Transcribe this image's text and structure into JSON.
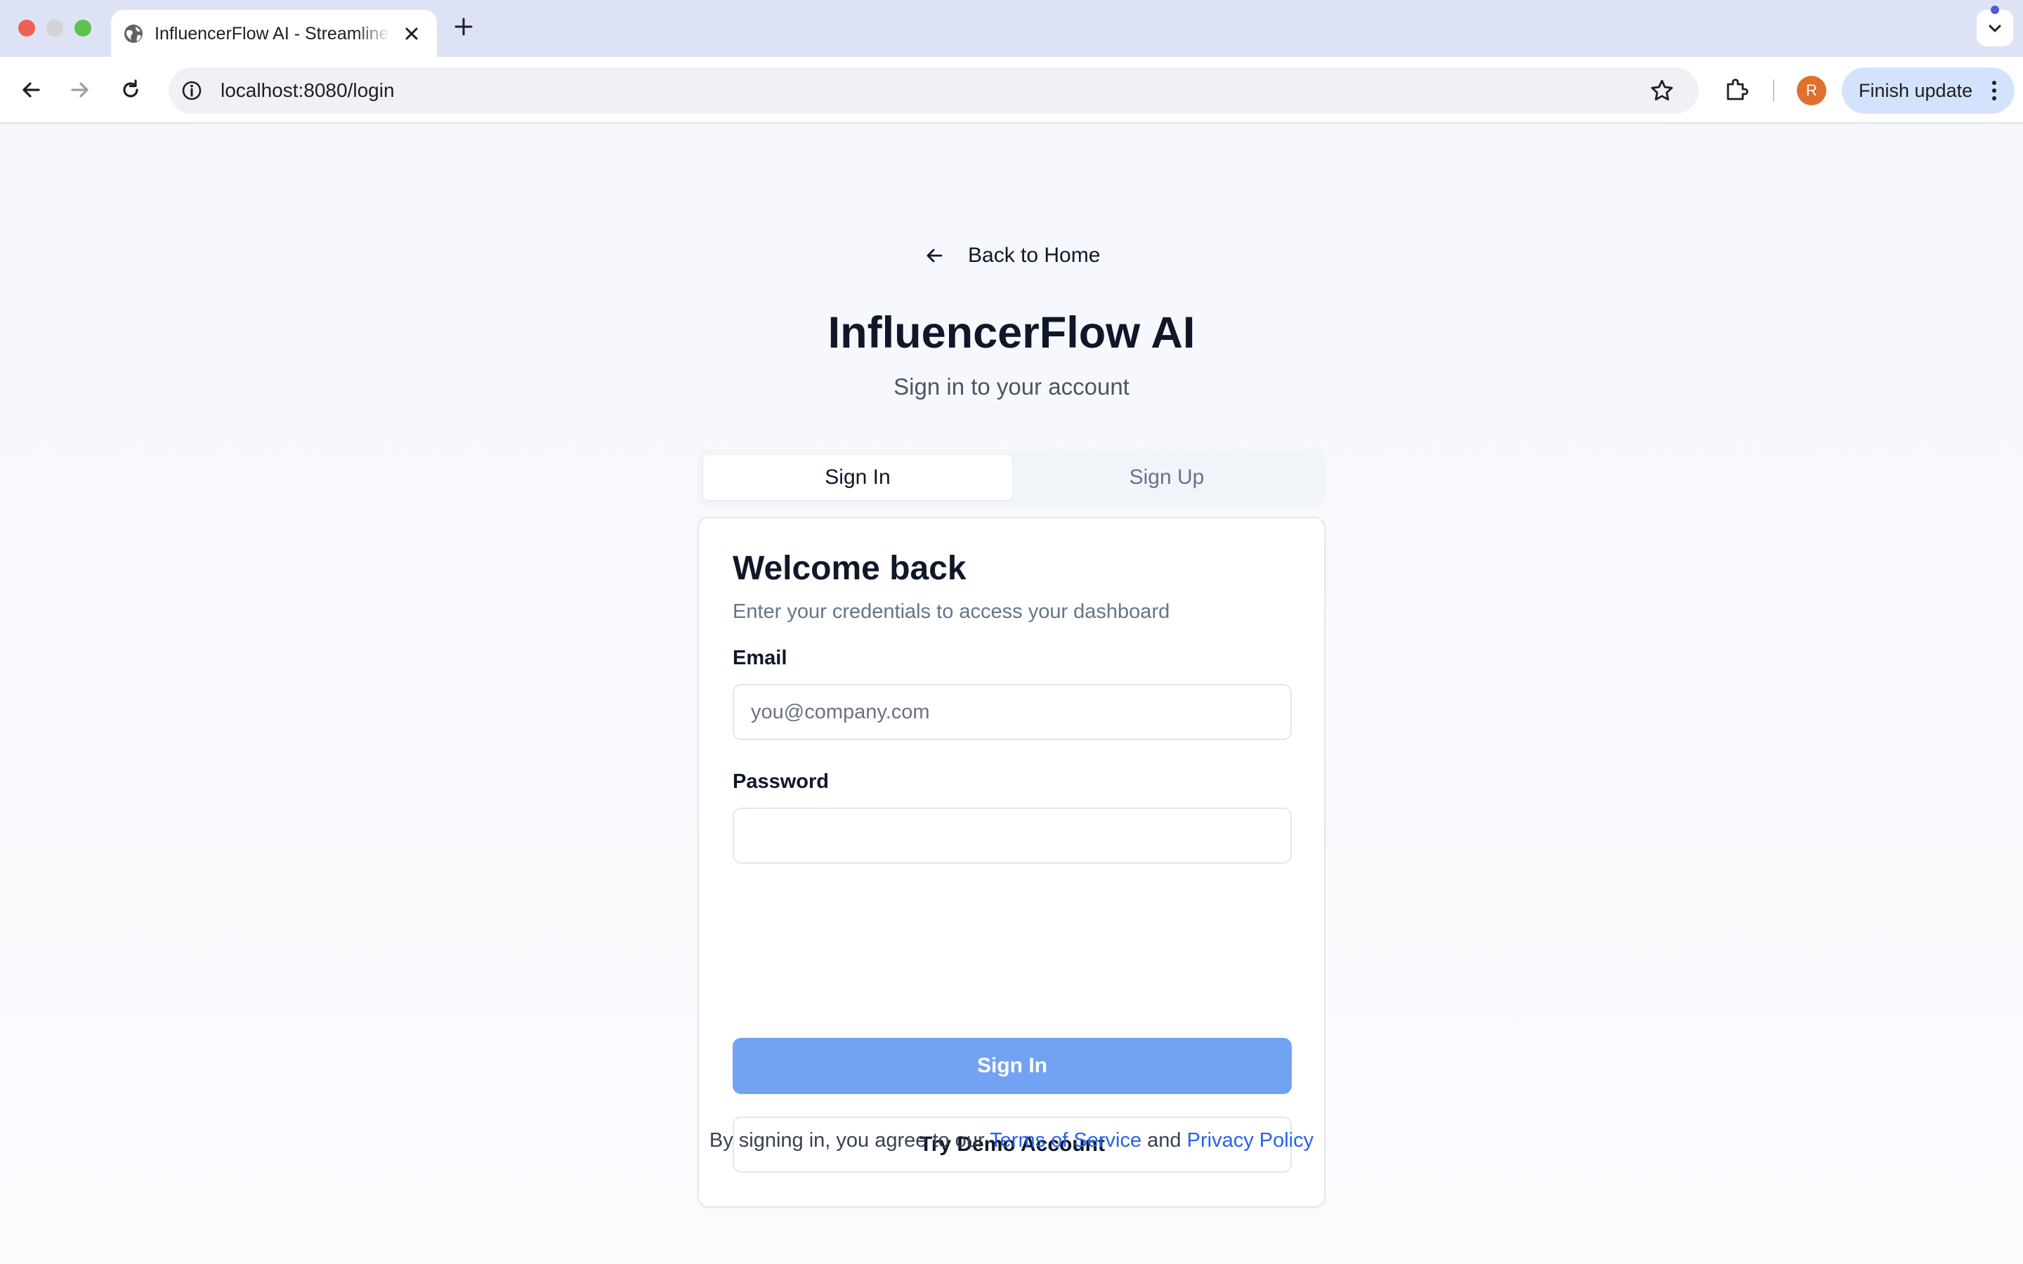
{
  "browser": {
    "tab": {
      "title": "InfluencerFlow AI - Streamlined Influencer Marketing",
      "favicon": "globe-icon",
      "close_icon": "close-icon"
    },
    "new_tab_icon": "plus-icon",
    "tab_search_icon": "chevron-down-icon",
    "address_bar": {
      "url": "localhost:8080/login",
      "info_icon": "info-icon",
      "bookmark_icon": "star-icon"
    },
    "extensions_icon": "puzzle-icon",
    "profile_initial": "R",
    "profile_color": "#e0702b",
    "update_button": "Finish update",
    "menu_icon": "kebab-menu-icon"
  },
  "page": {
    "back_link": "Back to Home",
    "title": "InfluencerFlow AI",
    "subtitle": "Sign in to your account",
    "tabs": [
      {
        "label": "Sign In",
        "active": true
      },
      {
        "label": "Sign Up",
        "active": false
      }
    ],
    "card": {
      "title": "Welcome back",
      "description": "Enter your credentials to access your dashboard",
      "email": {
        "label": "Email",
        "placeholder": "you@company.com",
        "value": ""
      },
      "password": {
        "label": "Password",
        "placeholder": "",
        "value": ""
      },
      "submit_label": "Sign In",
      "demo_label": "Try Demo Account"
    },
    "legal": {
      "prefix": "By signing in, you agree to our",
      "terms": "Terms of Service",
      "conjunction": "and",
      "privacy": "Privacy Policy"
    }
  },
  "colors": {
    "accent": "#2563eb",
    "primary_button": "#72a3f2",
    "text": "#0f172a",
    "muted": "#64748b"
  }
}
